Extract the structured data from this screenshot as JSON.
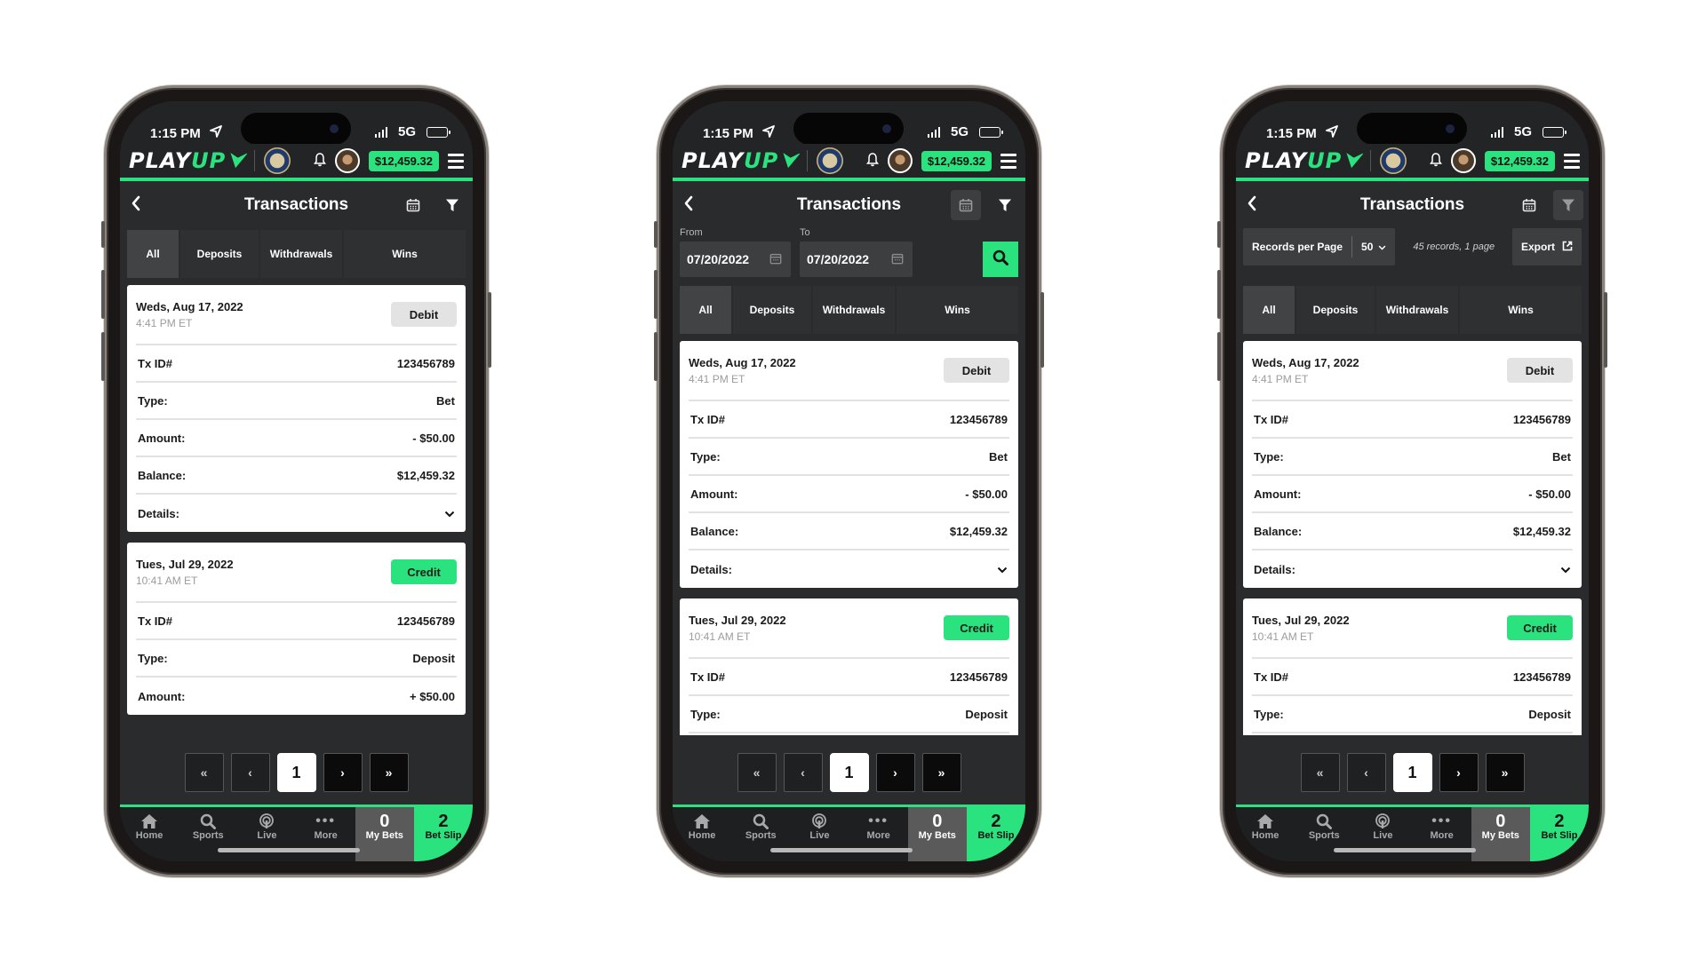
{
  "status_bar": {
    "time": "1:15 PM",
    "network": "5G"
  },
  "header": {
    "logo_play": "PLAY",
    "logo_up": "UP",
    "balance": "$12,459.32"
  },
  "title_bar": {
    "title": "Transactions"
  },
  "tabs": [
    {
      "label": "All",
      "active": true
    },
    {
      "label": "Deposits",
      "active": false
    },
    {
      "label": "Withdrawals",
      "active": false
    },
    {
      "label": "Wins",
      "active": false
    }
  ],
  "date_filter": {
    "from_label": "From",
    "from_value": "07/20/2022",
    "to_label": "To",
    "to_value": "07/20/2022"
  },
  "records_bar": {
    "label": "Records per Page",
    "per_page": "50",
    "summary": "45 records, 1 page",
    "export_label": "Export"
  },
  "transactions": [
    {
      "date": "Weds, Aug 17, 2022",
      "time": "4:41 PM ET",
      "badge": "Debit",
      "rows": [
        {
          "label": "Tx ID#",
          "value": "123456789"
        },
        {
          "label": "Type:",
          "value": "Bet"
        },
        {
          "label": "Amount:",
          "value": "- $50.00"
        },
        {
          "label": "Balance:",
          "value": "$12,459.32"
        },
        {
          "label": "Details:",
          "value": ""
        }
      ]
    },
    {
      "date": "Tues, Jul 29, 2022",
      "time": "10:41 AM ET",
      "badge": "Credit",
      "rows": [
        {
          "label": "Tx ID#",
          "value": "123456789"
        },
        {
          "label": "Type:",
          "value": "Deposit"
        },
        {
          "label": "Amount:",
          "value": "+ $50.00"
        }
      ]
    }
  ],
  "pager": {
    "first": "«",
    "prev": "‹",
    "current": "1",
    "next": "›",
    "last": "»"
  },
  "bottom_nav": {
    "home": "Home",
    "sports": "Sports",
    "live": "Live",
    "more": "More",
    "my_bets_label": "My Bets",
    "my_bets_count": "0",
    "bet_slip_label": "Bet Slip",
    "bet_slip_count": "2"
  },
  "colors": {
    "accent": "#2be37e",
    "background": "#2a2b2d",
    "card": "#ffffff",
    "debit_badge": "#e3e3e3"
  },
  "screens": [
    {
      "variant": "default",
      "active_toolbar_icon": "none"
    },
    {
      "variant": "date-filter",
      "active_toolbar_icon": "calendar"
    },
    {
      "variant": "records-per-page",
      "active_toolbar_icon": "filter"
    }
  ]
}
